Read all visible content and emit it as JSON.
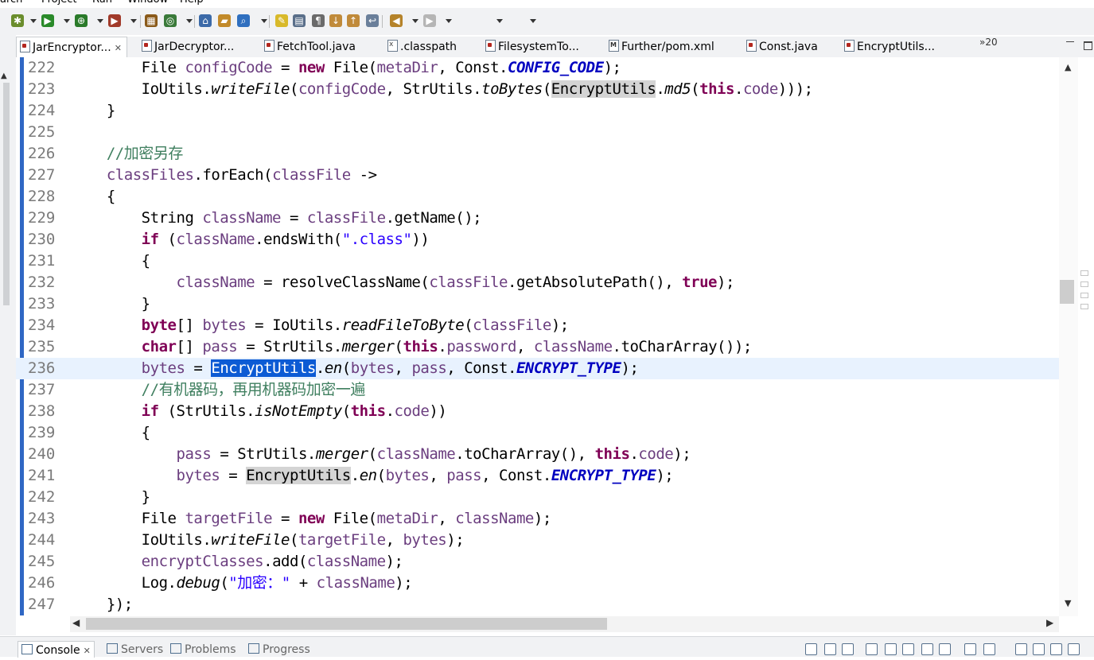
{
  "menu": {
    "items": [
      "arch",
      "Project",
      "Run",
      "Window",
      "Help"
    ]
  },
  "toolbar": {
    "icons": [
      "debug-icon",
      "run-icon",
      "coverage-icon",
      "external-tools-icon",
      "new-package-icon",
      "new-class-icon",
      "open-type-icon",
      "open-task-icon",
      "search-icon",
      "toggle-mark-occurrences-icon",
      "toggle-block-selection-icon",
      "show-whitespace-icon",
      "next-annotation-icon",
      "previous-annotation-icon",
      "last-edit-location-icon",
      "back-icon",
      "forward-icon"
    ]
  },
  "editor_tabs": [
    {
      "label": "JarEncryptor...",
      "active": true,
      "close": "✕",
      "kind": "java"
    },
    {
      "label": "JarDecryptor...",
      "active": false,
      "kind": "java"
    },
    {
      "label": "FetchTool.java",
      "active": false,
      "kind": "java"
    },
    {
      "label": ".classpath",
      "active": false,
      "kind": "xml"
    },
    {
      "label": "FilesystemTo...",
      "active": false,
      "kind": "java"
    },
    {
      "label": "Further/pom.xml",
      "active": false,
      "kind": "pom"
    },
    {
      "label": "Const.java",
      "active": false,
      "kind": "java"
    },
    {
      "label": "EncryptUtils...",
      "active": false,
      "kind": "java"
    }
  ],
  "tab_overflow": "»20",
  "current_line": 236,
  "code_lines": [
    {
      "n": "222",
      "t": [
        [
          "",
          "        File "
        ],
        [
          "fld",
          "configCode"
        ],
        [
          "",
          " = "
        ],
        [
          "kw",
          "new"
        ],
        [
          "",
          " File("
        ],
        [
          "fld",
          "metaDir"
        ],
        [
          "",
          ", Const."
        ],
        [
          "cst",
          "CONFIG_CODE"
        ],
        [
          "",
          ");"
        ]
      ]
    },
    {
      "n": "223",
      "t": [
        [
          "",
          "        IoUtils."
        ],
        [
          "sm",
          "writeFile"
        ],
        [
          "",
          "("
        ],
        [
          "fld",
          "configCode"
        ],
        [
          "",
          ", StrUtils."
        ],
        [
          "sm",
          "toBytes"
        ],
        [
          "",
          "("
        ],
        [
          "occ",
          "EncryptUtils"
        ],
        [
          "",
          "."
        ],
        [
          "sm",
          "md5"
        ],
        [
          "",
          "("
        ],
        [
          "kw",
          "this"
        ],
        [
          "",
          "."
        ],
        [
          "fld",
          "code"
        ],
        [
          "",
          ")));"
        ]
      ]
    },
    {
      "n": "224",
      "t": [
        [
          "",
          "    }"
        ]
      ]
    },
    {
      "n": "225",
      "t": [
        [
          "",
          ""
        ]
      ]
    },
    {
      "n": "226",
      "t": [
        [
          "",
          "    "
        ],
        [
          "cmt",
          "//加密另存"
        ]
      ]
    },
    {
      "n": "227",
      "t": [
        [
          "",
          "    "
        ],
        [
          "fld",
          "classFiles"
        ],
        [
          "",
          ".forEach("
        ],
        [
          "fld",
          "classFile"
        ],
        [
          "",
          " ->"
        ]
      ]
    },
    {
      "n": "228",
      "t": [
        [
          "",
          "    {"
        ]
      ]
    },
    {
      "n": "229",
      "t": [
        [
          "",
          "        String "
        ],
        [
          "fld",
          "className"
        ],
        [
          "",
          " = "
        ],
        [
          "fld",
          "classFile"
        ],
        [
          "",
          ".getName();"
        ]
      ]
    },
    {
      "n": "230",
      "t": [
        [
          "",
          "        "
        ],
        [
          "kw",
          "if"
        ],
        [
          "",
          " ("
        ],
        [
          "fld",
          "className"
        ],
        [
          "",
          ".endsWith("
        ],
        [
          "str",
          "\".class\""
        ],
        [
          "",
          "))"
        ]
      ]
    },
    {
      "n": "231",
      "t": [
        [
          "",
          "        {"
        ]
      ]
    },
    {
      "n": "232",
      "t": [
        [
          "",
          "            "
        ],
        [
          "fld",
          "className"
        ],
        [
          "",
          " = resolveClassName("
        ],
        [
          "fld",
          "classFile"
        ],
        [
          "",
          ".getAbsolutePath(), "
        ],
        [
          "kw",
          "true"
        ],
        [
          "",
          ");"
        ]
      ]
    },
    {
      "n": "233",
      "t": [
        [
          "",
          "        }"
        ]
      ]
    },
    {
      "n": "234",
      "t": [
        [
          "",
          "        "
        ],
        [
          "kw",
          "byte"
        ],
        [
          "",
          "[] "
        ],
        [
          "fld",
          "bytes"
        ],
        [
          "",
          " = IoUtils."
        ],
        [
          "sm",
          "readFileToByte"
        ],
        [
          "",
          "("
        ],
        [
          "fld",
          "classFile"
        ],
        [
          "",
          ");"
        ]
      ]
    },
    {
      "n": "235",
      "t": [
        [
          "",
          "        "
        ],
        [
          "kw",
          "char"
        ],
        [
          "",
          "[] "
        ],
        [
          "fld",
          "pass"
        ],
        [
          "",
          " = StrUtils."
        ],
        [
          "sm",
          "merger"
        ],
        [
          "",
          "("
        ],
        [
          "kw",
          "this"
        ],
        [
          "",
          "."
        ],
        [
          "fld",
          "password"
        ],
        [
          "",
          ", "
        ],
        [
          "fld",
          "className"
        ],
        [
          "",
          ".toCharArray());"
        ]
      ]
    },
    {
      "n": "236",
      "t": [
        [
          "",
          "        "
        ],
        [
          "fld",
          "bytes"
        ],
        [
          "",
          " = "
        ],
        [
          "sel",
          "EncryptUtils"
        ],
        [
          "",
          "."
        ],
        [
          "sm",
          "en"
        ],
        [
          "",
          "("
        ],
        [
          "fld",
          "bytes"
        ],
        [
          "",
          ", "
        ],
        [
          "fld",
          "pass"
        ],
        [
          "",
          ", Const."
        ],
        [
          "cst",
          "ENCRYPT_TYPE"
        ],
        [
          "",
          ");"
        ]
      ]
    },
    {
      "n": "237",
      "t": [
        [
          "",
          "        "
        ],
        [
          "cmt",
          "//有机器码，再用机器码加密一遍"
        ]
      ]
    },
    {
      "n": "238",
      "t": [
        [
          "",
          "        "
        ],
        [
          "kw",
          "if"
        ],
        [
          "",
          " (StrUtils."
        ],
        [
          "sm",
          "isNotEmpty"
        ],
        [
          "",
          "("
        ],
        [
          "kw",
          "this"
        ],
        [
          "",
          "."
        ],
        [
          "fld",
          "code"
        ],
        [
          "",
          "))"
        ]
      ]
    },
    {
      "n": "239",
      "t": [
        [
          "",
          "        {"
        ]
      ]
    },
    {
      "n": "240",
      "t": [
        [
          "",
          "            "
        ],
        [
          "fld",
          "pass"
        ],
        [
          "",
          " = StrUtils."
        ],
        [
          "sm",
          "merger"
        ],
        [
          "",
          "("
        ],
        [
          "fld",
          "className"
        ],
        [
          "",
          ".toCharArray(), "
        ],
        [
          "kw",
          "this"
        ],
        [
          "",
          "."
        ],
        [
          "fld",
          "code"
        ],
        [
          "",
          ");"
        ]
      ]
    },
    {
      "n": "241",
      "t": [
        [
          "",
          "            "
        ],
        [
          "fld",
          "bytes"
        ],
        [
          "",
          " = "
        ],
        [
          "occ",
          "EncryptUtils"
        ],
        [
          "",
          "."
        ],
        [
          "sm",
          "en"
        ],
        [
          "",
          "("
        ],
        [
          "fld",
          "bytes"
        ],
        [
          "",
          ", "
        ],
        [
          "fld",
          "pass"
        ],
        [
          "",
          ", Const."
        ],
        [
          "cst",
          "ENCRYPT_TYPE"
        ],
        [
          "",
          ");"
        ]
      ]
    },
    {
      "n": "242",
      "t": [
        [
          "",
          "        }"
        ]
      ]
    },
    {
      "n": "243",
      "t": [
        [
          "",
          "        File "
        ],
        [
          "fld",
          "targetFile"
        ],
        [
          "",
          " = "
        ],
        [
          "kw",
          "new"
        ],
        [
          "",
          " File("
        ],
        [
          "fld",
          "metaDir"
        ],
        [
          "",
          ", "
        ],
        [
          "fld",
          "className"
        ],
        [
          "",
          ");"
        ]
      ]
    },
    {
      "n": "244",
      "t": [
        [
          "",
          "        IoUtils."
        ],
        [
          "sm",
          "writeFile"
        ],
        [
          "",
          "("
        ],
        [
          "fld",
          "targetFile"
        ],
        [
          "",
          ", "
        ],
        [
          "fld",
          "bytes"
        ],
        [
          "",
          ");"
        ]
      ]
    },
    {
      "n": "245",
      "t": [
        [
          "",
          "        "
        ],
        [
          "fld",
          "encryptClasses"
        ],
        [
          "",
          ".add("
        ],
        [
          "fld",
          "className"
        ],
        [
          "",
          ");"
        ]
      ]
    },
    {
      "n": "246",
      "t": [
        [
          "",
          "        Log."
        ],
        [
          "sm",
          "debug"
        ],
        [
          "",
          "("
        ],
        [
          "str",
          "\"加密：\""
        ],
        [
          "",
          " + "
        ],
        [
          "fld",
          "className"
        ],
        [
          "",
          ");"
        ]
      ]
    },
    {
      "n": "247",
      "t": [
        [
          "",
          "    });"
        ]
      ]
    }
  ],
  "bottom_views": [
    {
      "label": "Console",
      "active": true,
      "close": "✕"
    },
    {
      "label": "Servers",
      "active": false
    },
    {
      "label": "Problems",
      "active": false
    },
    {
      "label": "Progress",
      "active": false
    }
  ],
  "colors": {
    "keyword": "#7f0055",
    "field": "#6b3e7f",
    "constant": "#0000c0",
    "string": "#2a00ff",
    "comment": "#3f7f5f",
    "selection": "#0c5bd4",
    "current_line": "#e8f2fe",
    "occurrence": "#d4d4d4"
  }
}
